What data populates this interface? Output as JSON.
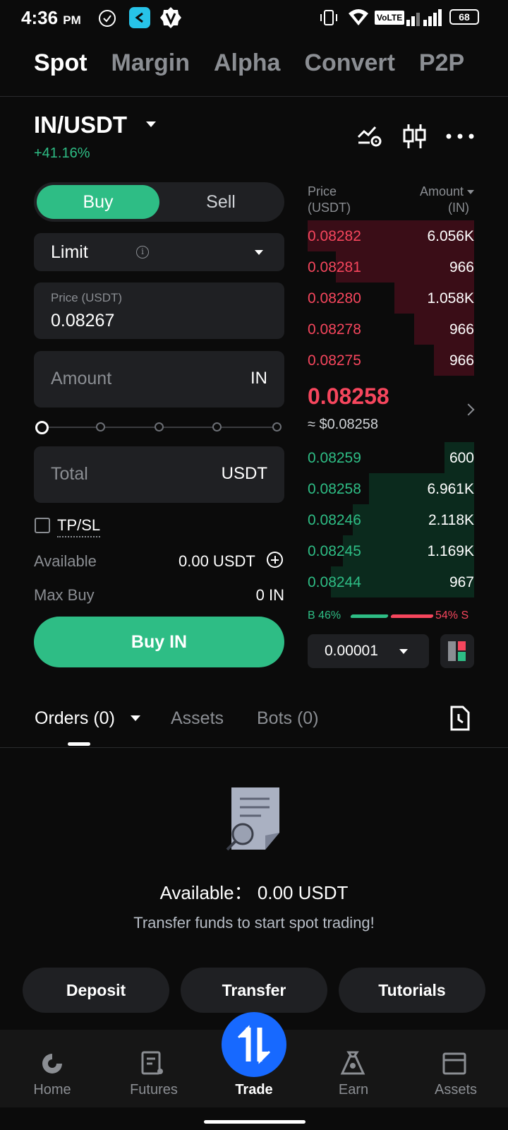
{
  "status_bar": {
    "time": "4:36",
    "ampm": "PM",
    "network": "VoLTE",
    "battery": "68"
  },
  "top_tabs": [
    "Spot",
    "Margin",
    "Alpha",
    "Convert",
    "P2P"
  ],
  "pair": {
    "name": "IN/USDT",
    "change": "+41.16%"
  },
  "form": {
    "buy_label": "Buy",
    "sell_label": "Sell",
    "order_type": "Limit",
    "price_label": "Price (USDT)",
    "price_value": "0.08267",
    "amount_placeholder": "Amount",
    "amount_unit": "IN",
    "total_placeholder": "Total",
    "total_unit": "USDT",
    "tpsl_label": "TP/SL",
    "available_label": "Available",
    "available_value": "0.00 USDT",
    "maxbuy_label": "Max Buy",
    "maxbuy_value": "0 IN",
    "submit_label": "Buy IN",
    "slider_percent": 0
  },
  "orderbook": {
    "price_header": "Price",
    "price_unit": "(USDT)",
    "amount_header": "Amount",
    "amount_unit": "(IN)",
    "asks": [
      {
        "price": "0.08282",
        "amount": "6.056K",
        "depth": 1.0
      },
      {
        "price": "0.08281",
        "amount": "966",
        "depth": 0.83
      },
      {
        "price": "0.08280",
        "amount": "1.058K",
        "depth": 0.48
      },
      {
        "price": "0.08278",
        "amount": "966",
        "depth": 0.36
      },
      {
        "price": "0.08275",
        "amount": "966",
        "depth": 0.24
      }
    ],
    "last_price": "0.08258",
    "last_price_usd": "≈ $0.08258",
    "bids": [
      {
        "price": "0.08259",
        "amount": "600",
        "depth": 0.18
      },
      {
        "price": "0.08258",
        "amount": "6.961K",
        "depth": 0.63
      },
      {
        "price": "0.08246",
        "amount": "2.118K",
        "depth": 0.73
      },
      {
        "price": "0.08245",
        "amount": "1.169K",
        "depth": 0.79
      },
      {
        "price": "0.08244",
        "amount": "967",
        "depth": 0.86
      }
    ],
    "buy_ratio": "B 46%",
    "sell_ratio": "54% S",
    "precision": "0.00001"
  },
  "orders_tabs": {
    "orders": "Orders (0)",
    "assets": "Assets",
    "bots": "Bots (0)"
  },
  "empty_state": {
    "title": "Available：  0.00 USDT",
    "subtitle": "Transfer funds to start spot trading!"
  },
  "actions": {
    "deposit": "Deposit",
    "transfer": "Transfer",
    "tutorials": "Tutorials"
  },
  "bottom_nav": {
    "home": "Home",
    "futures": "Futures",
    "trade": "Trade",
    "earn": "Earn",
    "assets": "Assets"
  },
  "colors": {
    "green": "#2ebd85",
    "red": "#f6465d",
    "blue": "#1769ff"
  }
}
